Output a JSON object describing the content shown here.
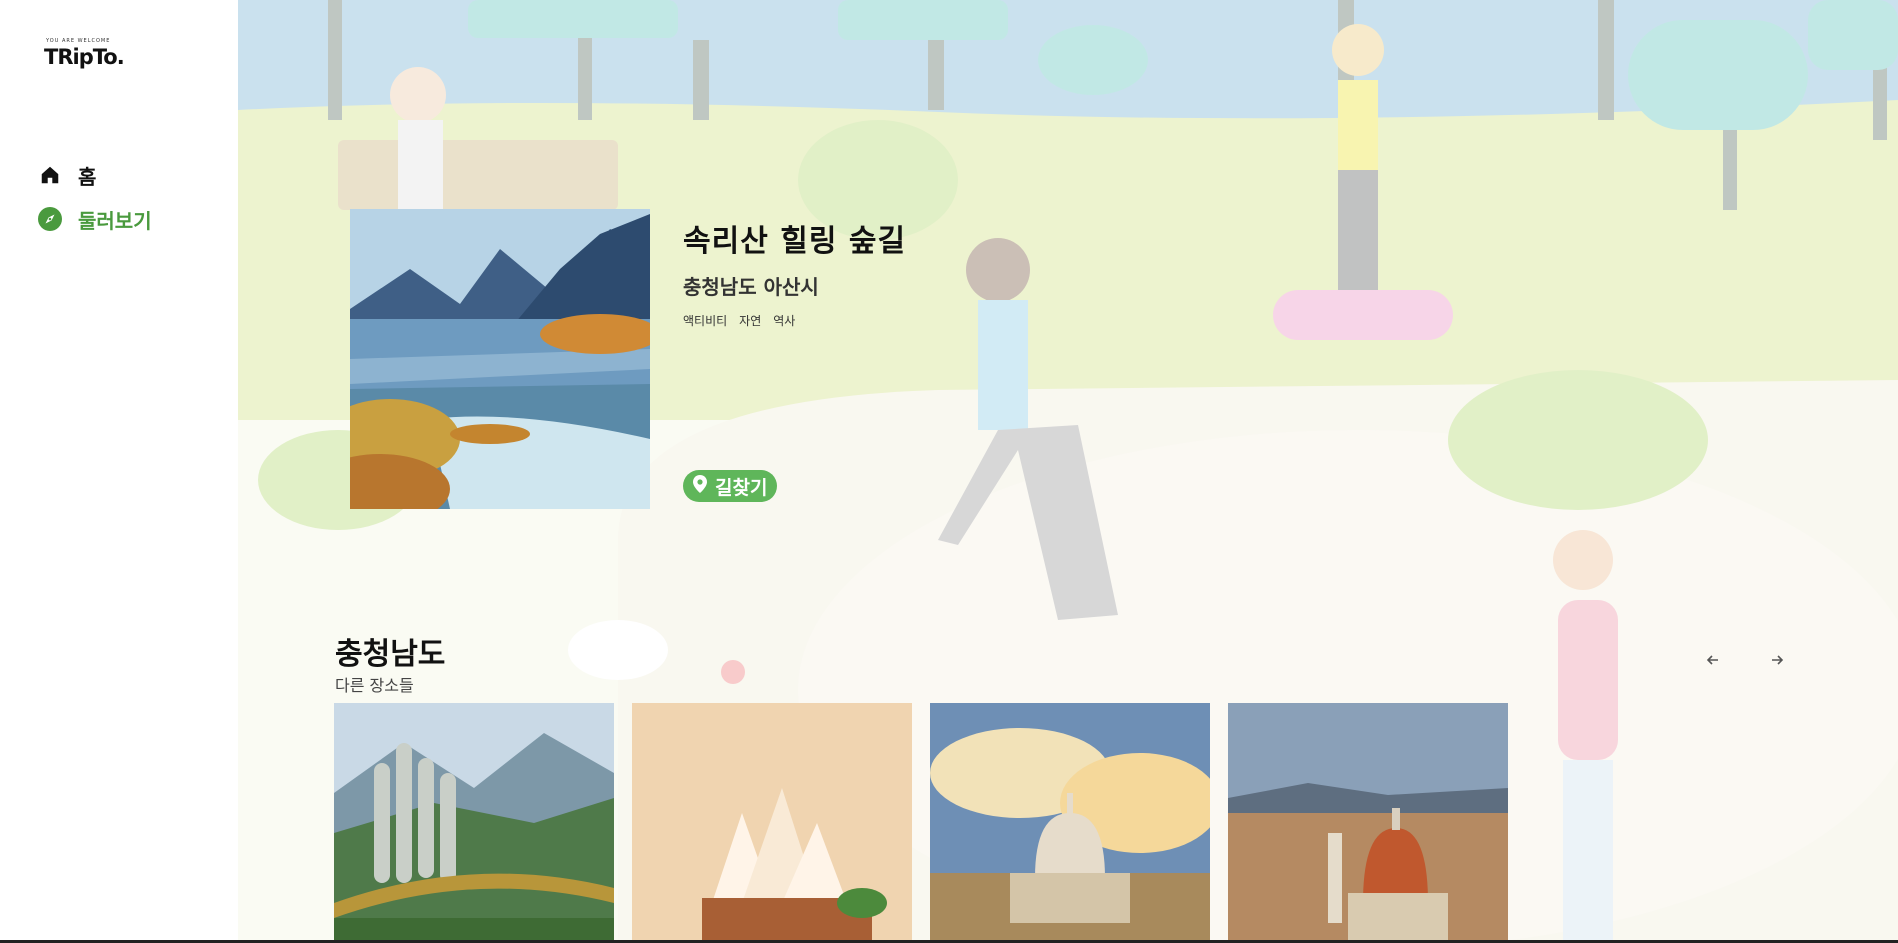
{
  "app": {
    "logo_tag": "YOU ARE WELCOME",
    "logo_name": "TRipTo."
  },
  "nav": {
    "items": [
      {
        "label": "홈",
        "icon": "home-icon"
      },
      {
        "label": "둘러보기",
        "icon": "compass-icon",
        "active": true
      }
    ]
  },
  "hero": {
    "title": "속리산 힐링 숲길",
    "region": "충청남도 아산시",
    "tags": [
      "액티비티",
      "자연",
      "역사"
    ],
    "route_label": "길찾기"
  },
  "section": {
    "title": "충청남도",
    "subtitle": "다른 장소들",
    "prev_icon": "arrow-left-icon",
    "next_icon": "arrow-right-icon"
  },
  "colors": {
    "accent": "#4a9a3e",
    "button": "#5fb65a"
  }
}
